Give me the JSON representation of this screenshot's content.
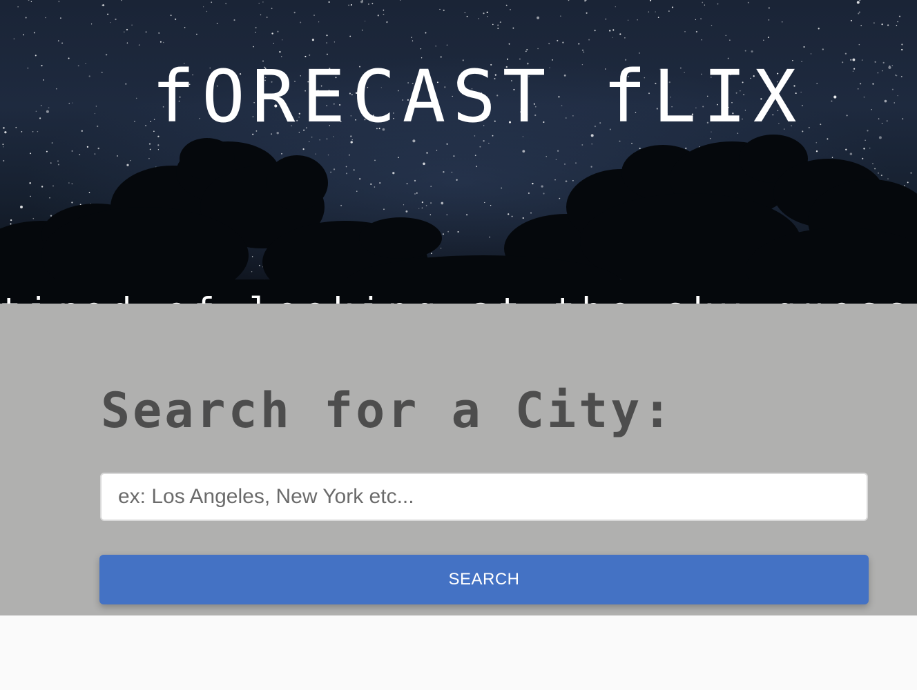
{
  "hero": {
    "title": "fORECAST fLIX",
    "tagline": "tired of looking at the sky guessing the weather"
  },
  "search": {
    "heading": "Search for a City:",
    "input_placeholder": "ex: Los Angeles, New York etc...",
    "input_value": "",
    "button_label": "SEARCH"
  },
  "colors": {
    "panel_bg": "#b0b0af",
    "heading_text": "#4d4d4d",
    "button_bg": "#4472c4",
    "page_bg": "#fafafa"
  }
}
